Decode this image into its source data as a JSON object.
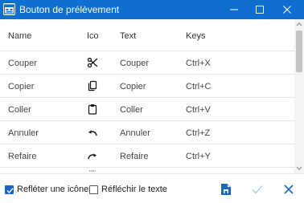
{
  "window": {
    "title": "Bouton de prélèvement",
    "icon": "app-window-icon",
    "controls": [
      "minimize-icon",
      "maximize-icon",
      "close-icon"
    ]
  },
  "table": {
    "headers": {
      "name": "Name",
      "ico": "Ico",
      "text": "Text",
      "keys": "Keys"
    },
    "rows": [
      {
        "name": "Couper",
        "icon": "scissors-icon",
        "text": "Couper",
        "keys": "Ctrl+X"
      },
      {
        "name": "Copier",
        "icon": "copy-icon",
        "text": "Copier",
        "keys": "Ctrl+C"
      },
      {
        "name": "Coller",
        "icon": "clipboard-icon",
        "text": "Coller",
        "keys": "Ctrl+V"
      },
      {
        "name": "Annuler",
        "icon": "undo-icon",
        "text": "Annuler",
        "keys": "Ctrl+Z"
      },
      {
        "name": "Refaire",
        "icon": "redo-icon",
        "text": "Refaire",
        "keys": "Ctrl+Y"
      }
    ]
  },
  "footer": {
    "reflect_icon": {
      "label": "Refléter une icône",
      "checked": true
    },
    "reflect_text": {
      "label": "Réfléchir le texte",
      "checked": false
    },
    "buttons": [
      "save-file-icon",
      "checkmark-icon",
      "close-icon"
    ]
  },
  "colors": {
    "titlebar": "#0f6fd1",
    "accent": "#1a66c8",
    "confirm_disabled": "#a9c6ea"
  }
}
